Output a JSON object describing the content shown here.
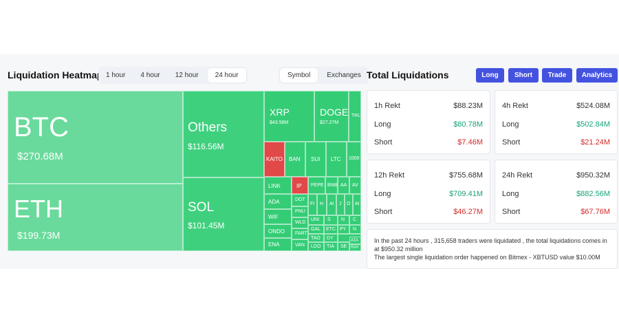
{
  "heatmap": {
    "title": "Liquidation Heatmap",
    "timeframes": [
      "1 hour",
      "4 hour",
      "12 hour",
      "24 hour"
    ],
    "active_timeframe": "24 hour",
    "views": [
      "Symbol",
      "Exchanges"
    ],
    "active_view": "Symbol",
    "tiles": [
      {
        "name": "BTC",
        "value": "$270.68M"
      },
      {
        "name": "ETH",
        "value": "$199.73M"
      },
      {
        "name": "Others",
        "value": "$116.56M"
      },
      {
        "name": "SOL",
        "value": "$101.45M"
      },
      {
        "name": "XRP",
        "value": "$43.58M"
      },
      {
        "name": "DOGE",
        "value": "$27.27M"
      },
      {
        "name": "TRU"
      },
      {
        "name": "KAITO"
      },
      {
        "name": "BAN"
      },
      {
        "name": "SUI"
      },
      {
        "name": "LTC"
      },
      {
        "name": "1000"
      },
      {
        "name": "LINK"
      },
      {
        "name": "IP"
      },
      {
        "name": "PEPE"
      },
      {
        "name": "BNB"
      },
      {
        "name": "AA"
      },
      {
        "name": "AV"
      },
      {
        "name": "ADA"
      },
      {
        "name": "DOT"
      },
      {
        "name": "FI"
      },
      {
        "name": "H"
      },
      {
        "name": "AI"
      },
      {
        "name": "J"
      },
      {
        "name": "O"
      },
      {
        "name": "AI"
      },
      {
        "name": "WIF"
      },
      {
        "name": "PNU"
      },
      {
        "name": "UNI"
      },
      {
        "name": "S"
      },
      {
        "name": "N"
      },
      {
        "name": "C"
      },
      {
        "name": "ONDO"
      },
      {
        "name": "WLD"
      },
      {
        "name": "GAL"
      },
      {
        "name": "ETC"
      },
      {
        "name": "PY"
      },
      {
        "name": "N"
      },
      {
        "name": "FART"
      },
      {
        "name": "TAO"
      },
      {
        "name": "DY"
      },
      {
        "name": "ENA"
      },
      {
        "name": "VAN"
      },
      {
        "name": "LDO"
      },
      {
        "name": "TIA"
      },
      {
        "name": "SE"
      },
      {
        "name": "ATA"
      },
      {
        "name": "RAY"
      }
    ]
  },
  "total": {
    "title": "Total Liquidations",
    "buttons": [
      "Long",
      "Short",
      "Trade",
      "Analytics"
    ],
    "cards": [
      {
        "label": "1h Rekt",
        "total": "$88.23M",
        "long_label": "Long",
        "long": "$80.78M",
        "short_label": "Short",
        "short": "$7.46M"
      },
      {
        "label": "4h Rekt",
        "total": "$524.08M",
        "long_label": "Long",
        "long": "$502.84M",
        "short_label": "Short",
        "short": "$21.24M"
      },
      {
        "label": "12h Rekt",
        "total": "$755.68M",
        "long_label": "Long",
        "long": "$709.41M",
        "short_label": "Short",
        "short": "$46.27M"
      },
      {
        "label": "24h Rekt",
        "total": "$950.32M",
        "long_label": "Long",
        "long": "$882.56M",
        "short_label": "Short",
        "short": "$67.76M"
      }
    ],
    "summary_line1": "In the past 24 hours , 315,658 traders were liquidated , the total liquidations comes in at $950.32 million",
    "summary_line2": "The largest single liquidation order happened on Bitmex - XBTUSD value $10.00M"
  },
  "colors": {
    "accent": "#4452e0",
    "tile_light": "#69da9b",
    "tile_green": "#3fd07e",
    "tile_red": "#e14848",
    "long": "#17a279",
    "short": "#d42a2a"
  }
}
